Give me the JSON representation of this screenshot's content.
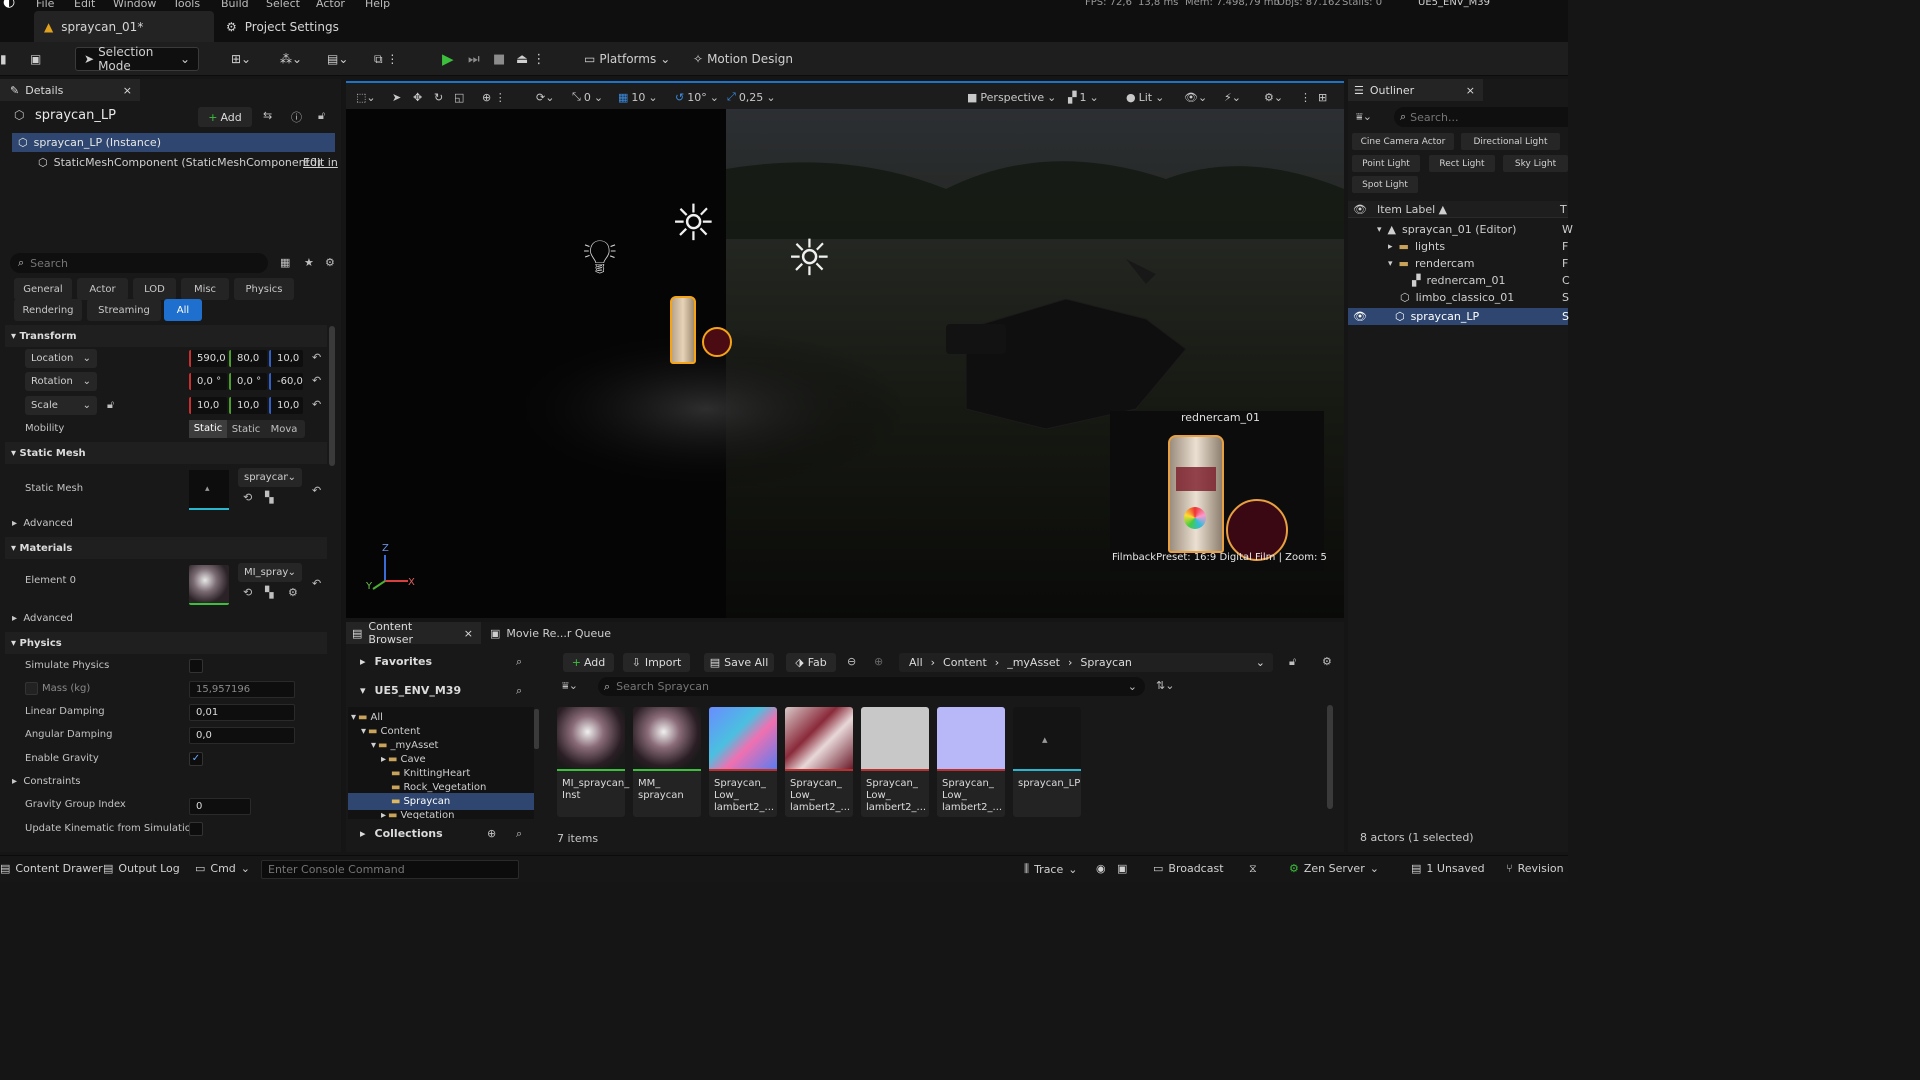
{
  "menu": {
    "items": [
      "File",
      "Edit",
      "Window",
      "Tools",
      "Build",
      "Select",
      "Actor",
      "Help"
    ],
    "fps": "FPS: 72,6",
    "ms": "13,8 ms",
    "mem": "Mem: 7.498,79 mb",
    "objs": "Objs: 87.162",
    "stalls": "Stalls: 0",
    "project": "UE5_ENV_M39"
  },
  "tabs": {
    "level": "spraycan_01*",
    "settings": "Project Settings"
  },
  "toolbar": {
    "selection_mode": "Selection Mode",
    "platforms": "Platforms",
    "motion_design": "Motion Design"
  },
  "details": {
    "panel_title": "Details",
    "actor_name": "spraycan_LP",
    "add": "Add",
    "instance": "spraycan_LP (Instance)",
    "component": "StaticMeshComponent (StaticMeshComponent0)",
    "edit_in": "Edit in",
    "search_placeholder": "Search",
    "filters": [
      "General",
      "Actor",
      "LOD",
      "Misc",
      "Physics",
      "Rendering",
      "Streaming",
      "All"
    ],
    "transform": {
      "title": "Transform",
      "location": "Location",
      "rotation": "Rotation",
      "scale": "Scale",
      "loc": [
        "590,0",
        "80,0",
        "10,0"
      ],
      "rot": [
        "0,0 °",
        "0,0 °",
        "-60,0"
      ],
      "scl": [
        "10,0",
        "10,0",
        "10,0"
      ],
      "mobility": "Mobility",
      "mob": [
        "Static",
        "Static",
        "Mova"
      ]
    },
    "static_mesh": {
      "title": "Static Mesh",
      "label": "Static Mesh",
      "value": "spraycan_LP",
      "advanced": "Advanced"
    },
    "materials": {
      "title": "Materials",
      "element0": "Element 0",
      "value": "MI_spraycan_Inst",
      "advanced": "Advanced"
    },
    "physics": {
      "title": "Physics",
      "simulate": "Simulate Physics",
      "mass": "Mass (kg)",
      "mass_val": "15,957196",
      "linear": "Linear Damping",
      "linear_val": "0,01",
      "angular": "Angular Damping",
      "angular_val": "0,0",
      "gravity": "Enable Gravity",
      "constraints": "Constraints",
      "group": "Gravity Group Index",
      "group_val": "0",
      "kinematic": "Update Kinematic from Simulation"
    }
  },
  "viewport": {
    "snap_angle": "0",
    "grid": "10",
    "rot_snap": "10°",
    "scale_snap": "0,25",
    "perspective": "Perspective",
    "cams": "1",
    "lit": "Lit",
    "pip_title": "rednercam_01",
    "pip_footer": "FilmbackPreset: 16:9 Digital Film | Zoom: 5",
    "axis": {
      "z": "Z",
      "x": "X",
      "y": "Y"
    }
  },
  "outliner": {
    "title": "Outliner",
    "search_placeholder": "Search...",
    "chips": [
      "Cine Camera Actor",
      "Directional Light",
      "Point Light",
      "Rect Light",
      "Sky Light",
      "Spot Light"
    ],
    "column": "Item Label ▲",
    "type_col": "T",
    "items": [
      {
        "label": "spraycan_01 (Editor)",
        "t": "W"
      },
      {
        "label": "lights",
        "t": "F"
      },
      {
        "label": "rendercam",
        "t": "F"
      },
      {
        "label": "rednercam_01",
        "t": "C"
      },
      {
        "label": "limbo_classico_01",
        "t": "S"
      },
      {
        "label": "spraycan_LP",
        "t": "S"
      }
    ],
    "footer": "8 actors (1 selected)"
  },
  "content_browser": {
    "tab1": "Content Browser",
    "tab2": "Movie Re...r Queue",
    "favorites": "Favorites",
    "project": "UE5_ENV_M39",
    "add": "Add",
    "import": "Import",
    "save_all": "Save All",
    "fab": "Fab",
    "path": [
      "All",
      "Content",
      "_myAsset",
      "Spraycan"
    ],
    "search_placeholder": "Search Spraycan",
    "tree": [
      "All",
      "Content",
      "_myAsset",
      "Cave",
      "KnittingHeart",
      "Rock_Vegetation",
      "Spraycan",
      "Vegetation"
    ],
    "collections": "Collections",
    "count": "7 items",
    "assets": [
      {
        "label": "MI_spraycan_\nInst"
      },
      {
        "label": "MM_\nspraycan"
      },
      {
        "label": "Spraycan_\nLow_\nlambert2_..."
      },
      {
        "label": "Spraycan_\nLow_\nlambert2_..."
      },
      {
        "label": "Spraycan_\nLow_\nlambert2_..."
      },
      {
        "label": "Spraycan_\nLow_\nlambert2_..."
      },
      {
        "label": "spraycan_LP"
      }
    ]
  },
  "statusbar": {
    "drawer": "Content Drawer",
    "output": "Output Log",
    "cmd": "Cmd",
    "console_placeholder": "Enter Console Command",
    "trace": "Trace",
    "broadcast": "Broadcast",
    "zen": "Zen Server",
    "unsaved": "1 Unsaved",
    "revision": "Revision"
  }
}
